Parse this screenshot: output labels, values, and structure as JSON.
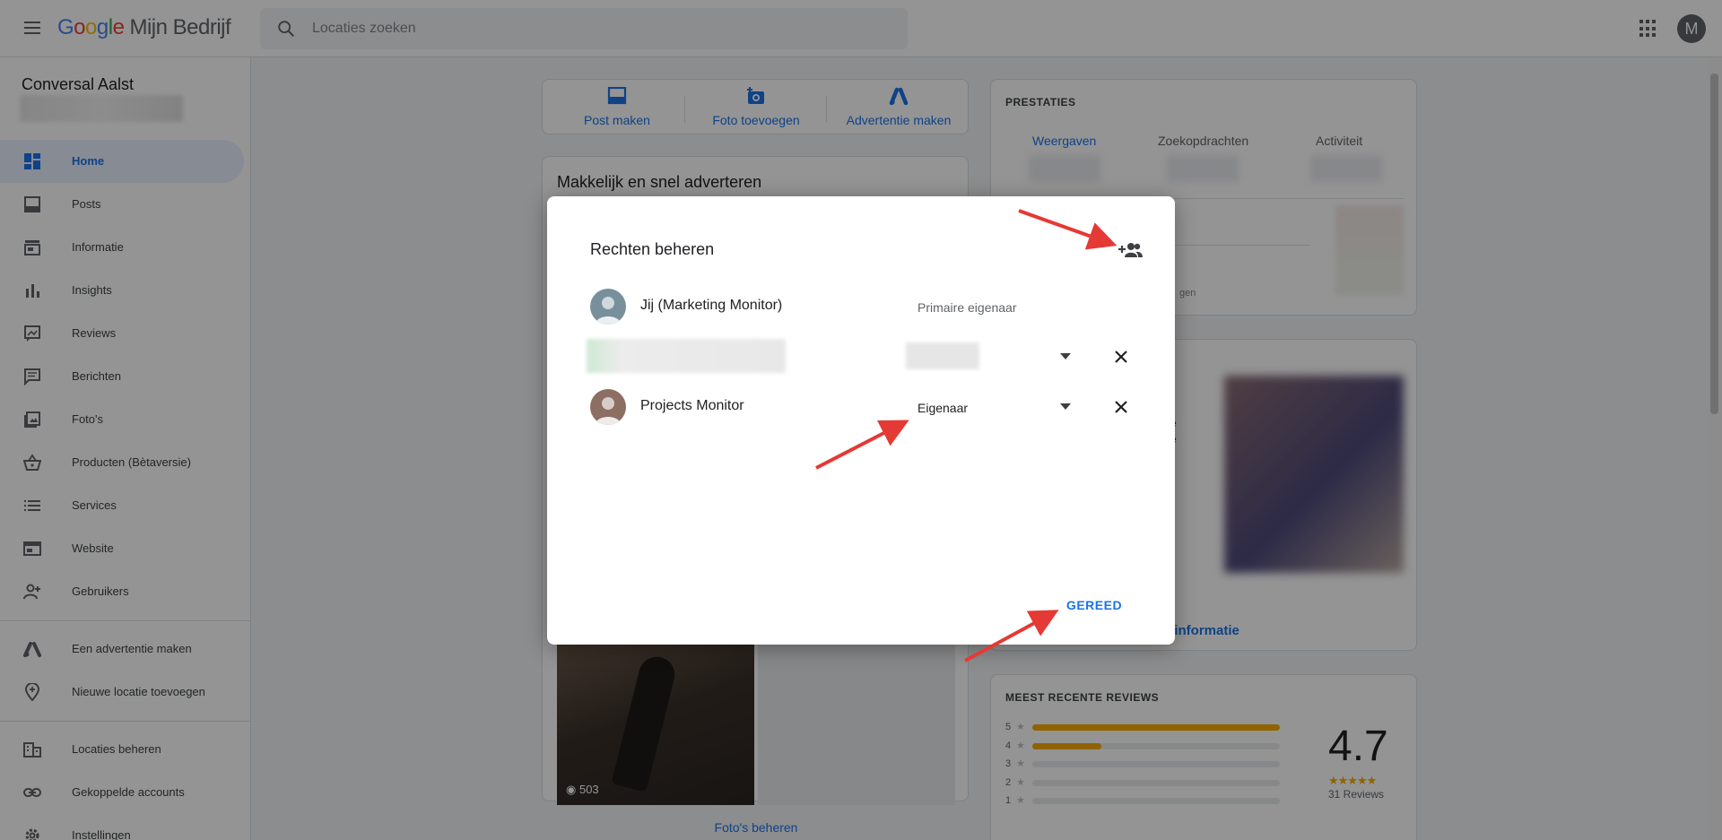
{
  "app": {
    "brand_google": "Google",
    "brand_rest": "Mijn Bedrijf"
  },
  "search": {
    "placeholder": "Locaties zoeken"
  },
  "account": {
    "initial": "M"
  },
  "sidebar": {
    "business_name": "Conversal Aalst",
    "items": [
      {
        "label": "Home",
        "icon": "dashboard-icon",
        "active": true
      },
      {
        "label": "Posts",
        "icon": "post-icon"
      },
      {
        "label": "Informatie",
        "icon": "store-icon"
      },
      {
        "label": "Insights",
        "icon": "bar-chart-icon"
      },
      {
        "label": "Reviews",
        "icon": "review-icon"
      },
      {
        "label": "Berichten",
        "icon": "message-icon"
      },
      {
        "label": "Foto's",
        "icon": "photo-icon"
      },
      {
        "label": "Producten (Bètaversie)",
        "icon": "basket-icon"
      },
      {
        "label": "Services",
        "icon": "list-icon"
      },
      {
        "label": "Website",
        "icon": "website-icon"
      },
      {
        "label": "Gebruikers",
        "icon": "add-person-icon"
      },
      {
        "label": "Een advertentie maken",
        "icon": "ads-icon"
      },
      {
        "label": "Nieuwe locatie toevoegen",
        "icon": "location-add-icon"
      },
      {
        "label": "Locaties beheren",
        "icon": "building-icon"
      },
      {
        "label": "Gekoppelde accounts",
        "icon": "link-icon"
      },
      {
        "label": "Instellingen",
        "icon": "gear-icon"
      }
    ]
  },
  "actions": {
    "post": "Post maken",
    "photo": "Foto toevoegen",
    "ad": "Advertentie maken"
  },
  "ads_card": {
    "title": "Makkelijk en snel adverteren",
    "views": "503",
    "manage_photos": "Foto's beheren"
  },
  "performance": {
    "title": "PRESTATIES",
    "tabs": [
      "Weergaven",
      "Zoekopdrachten",
      "Activiteit"
    ],
    "footer_fragment": "gen"
  },
  "info_card": {
    "text_fragments": [
      "e",
      "e",
      "."
    ],
    "link": "er informatie"
  },
  "reviews": {
    "title": "MEEST RECENTE REVIEWS",
    "score": "4.7",
    "stars": "★★★★★",
    "count": "31 Reviews",
    "distribution": [
      {
        "star": "5",
        "fraction": 1.0
      },
      {
        "star": "4",
        "fraction": 0.28
      },
      {
        "star": "3",
        "fraction": 0
      },
      {
        "star": "2",
        "fraction": 0
      },
      {
        "star": "1",
        "fraction": 0
      }
    ]
  },
  "dialog": {
    "title": "Rechten beheren",
    "users": [
      {
        "name": "Jij (Marketing Monitor)",
        "role": "Primaire eigenaar"
      },
      {
        "name": "",
        "role": ""
      },
      {
        "name": "Projects Monitor",
        "role": "Eigenaar"
      }
    ],
    "done_label": "GEREED"
  },
  "colors": {
    "accent": "#1a73e8",
    "star": "#f9ab00",
    "annotation_arrow": "#e53935"
  }
}
